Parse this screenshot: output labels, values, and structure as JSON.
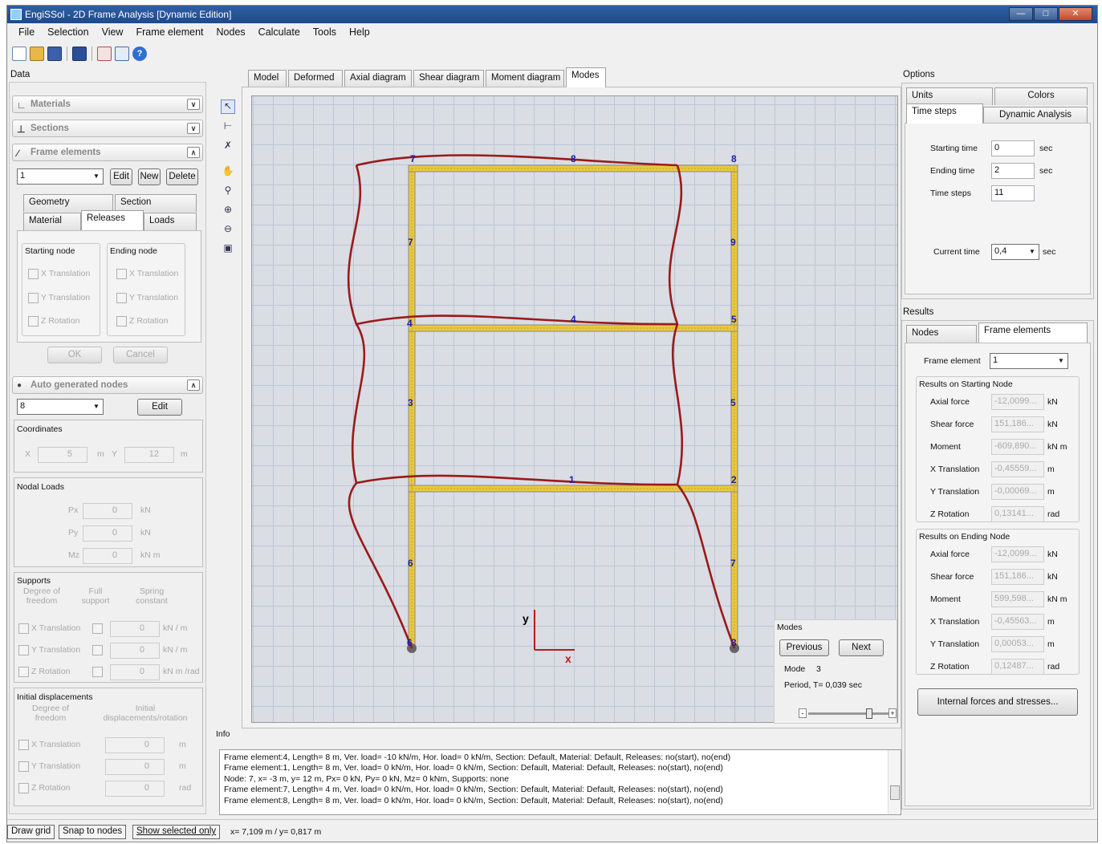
{
  "window": {
    "title": "EngiSSol - 2D Frame Analysis [Dynamic Edition]"
  },
  "menu": [
    "File",
    "Selection",
    "View",
    "Frame element",
    "Nodes",
    "Calculate",
    "Tools",
    "Help"
  ],
  "toolbar_icons": [
    "new-icon",
    "open-icon",
    "save-icon",
    "print-icon",
    "chart-icon",
    "report-icon",
    "help-icon"
  ],
  "left": {
    "title": "Data",
    "materials": "Materials",
    "sections": "Sections",
    "frame_elements": "Frame elements",
    "frame_combo": "1",
    "btn_edit": "Edit",
    "btn_new": "New",
    "btn_delete": "Delete",
    "tabs": [
      "Geometry",
      "Section",
      "Material",
      "Releases",
      "Loads"
    ],
    "starting_node": "Starting node",
    "ending_node": "Ending node",
    "x_translation": "X Translation",
    "y_translation": "Y Translation",
    "z_rotation": "Z Rotation",
    "ok": "OK",
    "cancel": "Cancel",
    "auto_nodes": "Auto generated nodes",
    "node_combo": "8",
    "node_edit": "Edit",
    "coordinates": "Coordinates",
    "x": "X",
    "y": "Y",
    "x_val": "5",
    "y_val": "12",
    "m": "m",
    "nodal_loads": "Nodal Loads",
    "px": "Px",
    "py": "Py",
    "mz": "Mz",
    "zero": "0",
    "kn": "kN",
    "knm": "kN  m",
    "supports": "Supports",
    "dof": "Degree of freedom",
    "full_support": "Full support",
    "spring_constant": "Spring constant",
    "kn_m": "kN  / m",
    "knm_rad": "kN m /rad",
    "initial_displacements": "Initial displacements",
    "init_disp_rot": "Initial displacements/rotation",
    "rad": "rad"
  },
  "center": {
    "tabs": [
      "Model",
      "Deformed",
      "Axial diagram",
      "Shear diagram",
      "Moment diagram",
      "Modes"
    ],
    "active_tab": "Modes",
    "node_labels": [
      "7",
      "8",
      "8",
      "4",
      "5",
      "1",
      "2",
      "3",
      "4",
      "6"
    ],
    "element_labels": [
      "7",
      "9",
      "3",
      "5",
      "6",
      "7"
    ],
    "axis_x": "x",
    "axis_y": "y",
    "modes": {
      "title": "Modes",
      "previous": "Previous",
      "next": "Next",
      "mode_label": "Mode",
      "mode_value": "3",
      "period": "Period, T= 0,039 sec"
    }
  },
  "info": {
    "title": "Info",
    "lines": [
      "Frame element:4, Length= 8 m, Ver. load= -10 kN/m, Hor. load= 0 kN/m, Section: Default, Material: Default, Releases: no(start), no(end)",
      "Frame element:1, Length= 8 m, Ver. load= 0 kN/m, Hor. load= 0 kN/m, Section: Default, Material: Default, Releases: no(start), no(end)",
      "Node: 7, x= -3 m, y= 12 m, Px= 0 kN, Py= 0 kN, Mz= 0 kNm, Supports: none",
      "Frame element:7, Length= 4 m, Ver. load= 0 kN/m, Hor. load= 0 kN/m, Section: Default, Material: Default, Releases: no(start), no(end)",
      "Frame element:8, Length= 8 m, Ver. load= 0 kN/m, Hor. load= 0 kN/m, Section: Default, Material: Default, Releases: no(start), no(end)"
    ]
  },
  "right": {
    "options": "Options",
    "tabs1": [
      "Units",
      "Colors",
      "Time steps",
      "Dynamic Analysis"
    ],
    "starting_time": "Starting time",
    "starting_time_val": "0",
    "ending_time": "Ending time",
    "ending_time_val": "2",
    "time_steps": "Time steps",
    "time_steps_val": "11",
    "current_time": "Current time",
    "current_time_val": "0,4",
    "sec": "sec",
    "results": "Results",
    "tabs2": [
      "Nodes",
      "Frame elements"
    ],
    "frame_element": "Frame element",
    "frame_element_val": "1",
    "start_group": "Results on Starting Node",
    "end_group": "Results on Ending Node",
    "rows": [
      "Axial force",
      "Shear force",
      "Moment",
      "X Translation",
      "Y Translation",
      "Z Rotation"
    ],
    "units": [
      "kN",
      "kN",
      "kN m",
      "m",
      "m",
      "rad"
    ],
    "start_vals": [
      "-12,0099...",
      "151,186...",
      "-609,890...",
      "-0,45559...",
      "-0,00069...",
      "0,13141..."
    ],
    "end_vals": [
      "-12,0099...",
      "151,186...",
      "599,598...",
      "-0,45563...",
      "0,00053...",
      "0,12487..."
    ],
    "internal_btn": "Internal forces and stresses..."
  },
  "status": {
    "draw_grid": "Draw grid",
    "snap": "Snap to nodes",
    "show_selected": "Show selected only",
    "coords": "x= 7,109 m / y= 0,817 m"
  }
}
